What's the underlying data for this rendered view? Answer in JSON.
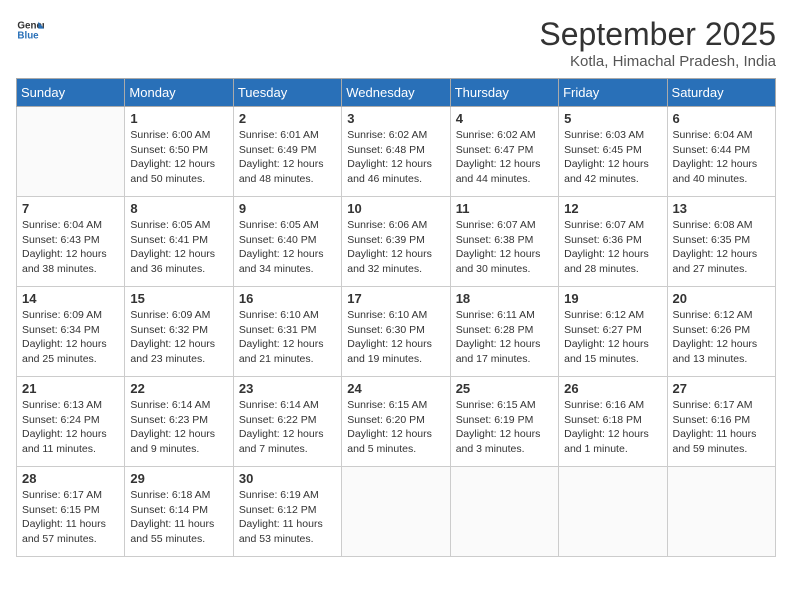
{
  "logo": {
    "line1": "General",
    "line2": "Blue"
  },
  "title": "September 2025",
  "location": "Kotla, Himachal Pradesh, India",
  "days_of_week": [
    "Sunday",
    "Monday",
    "Tuesday",
    "Wednesday",
    "Thursday",
    "Friday",
    "Saturday"
  ],
  "weeks": [
    [
      {
        "day": "",
        "sunrise": "",
        "sunset": "",
        "daylight": ""
      },
      {
        "day": "1",
        "sunrise": "Sunrise: 6:00 AM",
        "sunset": "Sunset: 6:50 PM",
        "daylight": "Daylight: 12 hours and 50 minutes."
      },
      {
        "day": "2",
        "sunrise": "Sunrise: 6:01 AM",
        "sunset": "Sunset: 6:49 PM",
        "daylight": "Daylight: 12 hours and 48 minutes."
      },
      {
        "day": "3",
        "sunrise": "Sunrise: 6:02 AM",
        "sunset": "Sunset: 6:48 PM",
        "daylight": "Daylight: 12 hours and 46 minutes."
      },
      {
        "day": "4",
        "sunrise": "Sunrise: 6:02 AM",
        "sunset": "Sunset: 6:47 PM",
        "daylight": "Daylight: 12 hours and 44 minutes."
      },
      {
        "day": "5",
        "sunrise": "Sunrise: 6:03 AM",
        "sunset": "Sunset: 6:45 PM",
        "daylight": "Daylight: 12 hours and 42 minutes."
      },
      {
        "day": "6",
        "sunrise": "Sunrise: 6:04 AM",
        "sunset": "Sunset: 6:44 PM",
        "daylight": "Daylight: 12 hours and 40 minutes."
      }
    ],
    [
      {
        "day": "7",
        "sunrise": "Sunrise: 6:04 AM",
        "sunset": "Sunset: 6:43 PM",
        "daylight": "Daylight: 12 hours and 38 minutes."
      },
      {
        "day": "8",
        "sunrise": "Sunrise: 6:05 AM",
        "sunset": "Sunset: 6:41 PM",
        "daylight": "Daylight: 12 hours and 36 minutes."
      },
      {
        "day": "9",
        "sunrise": "Sunrise: 6:05 AM",
        "sunset": "Sunset: 6:40 PM",
        "daylight": "Daylight: 12 hours and 34 minutes."
      },
      {
        "day": "10",
        "sunrise": "Sunrise: 6:06 AM",
        "sunset": "Sunset: 6:39 PM",
        "daylight": "Daylight: 12 hours and 32 minutes."
      },
      {
        "day": "11",
        "sunrise": "Sunrise: 6:07 AM",
        "sunset": "Sunset: 6:38 PM",
        "daylight": "Daylight: 12 hours and 30 minutes."
      },
      {
        "day": "12",
        "sunrise": "Sunrise: 6:07 AM",
        "sunset": "Sunset: 6:36 PM",
        "daylight": "Daylight: 12 hours and 28 minutes."
      },
      {
        "day": "13",
        "sunrise": "Sunrise: 6:08 AM",
        "sunset": "Sunset: 6:35 PM",
        "daylight": "Daylight: 12 hours and 27 minutes."
      }
    ],
    [
      {
        "day": "14",
        "sunrise": "Sunrise: 6:09 AM",
        "sunset": "Sunset: 6:34 PM",
        "daylight": "Daylight: 12 hours and 25 minutes."
      },
      {
        "day": "15",
        "sunrise": "Sunrise: 6:09 AM",
        "sunset": "Sunset: 6:32 PM",
        "daylight": "Daylight: 12 hours and 23 minutes."
      },
      {
        "day": "16",
        "sunrise": "Sunrise: 6:10 AM",
        "sunset": "Sunset: 6:31 PM",
        "daylight": "Daylight: 12 hours and 21 minutes."
      },
      {
        "day": "17",
        "sunrise": "Sunrise: 6:10 AM",
        "sunset": "Sunset: 6:30 PM",
        "daylight": "Daylight: 12 hours and 19 minutes."
      },
      {
        "day": "18",
        "sunrise": "Sunrise: 6:11 AM",
        "sunset": "Sunset: 6:28 PM",
        "daylight": "Daylight: 12 hours and 17 minutes."
      },
      {
        "day": "19",
        "sunrise": "Sunrise: 6:12 AM",
        "sunset": "Sunset: 6:27 PM",
        "daylight": "Daylight: 12 hours and 15 minutes."
      },
      {
        "day": "20",
        "sunrise": "Sunrise: 6:12 AM",
        "sunset": "Sunset: 6:26 PM",
        "daylight": "Daylight: 12 hours and 13 minutes."
      }
    ],
    [
      {
        "day": "21",
        "sunrise": "Sunrise: 6:13 AM",
        "sunset": "Sunset: 6:24 PM",
        "daylight": "Daylight: 12 hours and 11 minutes."
      },
      {
        "day": "22",
        "sunrise": "Sunrise: 6:14 AM",
        "sunset": "Sunset: 6:23 PM",
        "daylight": "Daylight: 12 hours and 9 minutes."
      },
      {
        "day": "23",
        "sunrise": "Sunrise: 6:14 AM",
        "sunset": "Sunset: 6:22 PM",
        "daylight": "Daylight: 12 hours and 7 minutes."
      },
      {
        "day": "24",
        "sunrise": "Sunrise: 6:15 AM",
        "sunset": "Sunset: 6:20 PM",
        "daylight": "Daylight: 12 hours and 5 minutes."
      },
      {
        "day": "25",
        "sunrise": "Sunrise: 6:15 AM",
        "sunset": "Sunset: 6:19 PM",
        "daylight": "Daylight: 12 hours and 3 minutes."
      },
      {
        "day": "26",
        "sunrise": "Sunrise: 6:16 AM",
        "sunset": "Sunset: 6:18 PM",
        "daylight": "Daylight: 12 hours and 1 minute."
      },
      {
        "day": "27",
        "sunrise": "Sunrise: 6:17 AM",
        "sunset": "Sunset: 6:16 PM",
        "daylight": "Daylight: 11 hours and 59 minutes."
      }
    ],
    [
      {
        "day": "28",
        "sunrise": "Sunrise: 6:17 AM",
        "sunset": "Sunset: 6:15 PM",
        "daylight": "Daylight: 11 hours and 57 minutes."
      },
      {
        "day": "29",
        "sunrise": "Sunrise: 6:18 AM",
        "sunset": "Sunset: 6:14 PM",
        "daylight": "Daylight: 11 hours and 55 minutes."
      },
      {
        "day": "30",
        "sunrise": "Sunrise: 6:19 AM",
        "sunset": "Sunset: 6:12 PM",
        "daylight": "Daylight: 11 hours and 53 minutes."
      },
      {
        "day": "",
        "sunrise": "",
        "sunset": "",
        "daylight": ""
      },
      {
        "day": "",
        "sunrise": "",
        "sunset": "",
        "daylight": ""
      },
      {
        "day": "",
        "sunrise": "",
        "sunset": "",
        "daylight": ""
      },
      {
        "day": "",
        "sunrise": "",
        "sunset": "",
        "daylight": ""
      }
    ]
  ]
}
